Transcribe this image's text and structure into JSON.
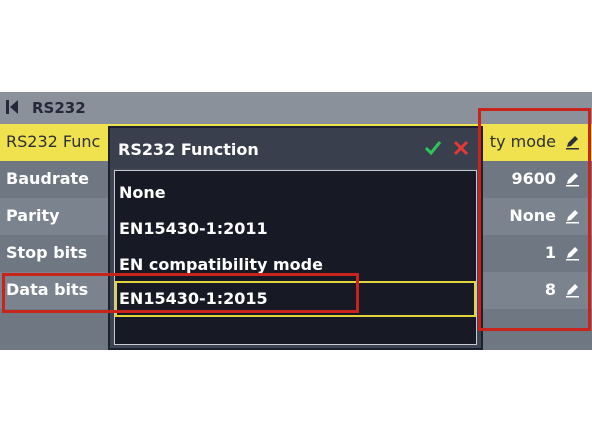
{
  "titlebar": {
    "title": "RS232"
  },
  "rows": [
    {
      "label": "RS232 Func",
      "value": "ty mode"
    },
    {
      "label": "Baudrate",
      "value": "9600"
    },
    {
      "label": "Parity",
      "value": "None"
    },
    {
      "label": "Stop bits",
      "value": "1"
    },
    {
      "label": "Data bits",
      "value": "8"
    }
  ],
  "dialog": {
    "title": "RS232 Function",
    "options": [
      "None",
      "EN15430-1:2011",
      "EN compatibility mode",
      "EN15430-1:2015"
    ],
    "selected_index": 3
  },
  "colors": {
    "accent_yellow": "#f0e14f",
    "ok_green": "#2fc45a",
    "cancel_red": "#e53935",
    "annotation_red": "#c8241c"
  },
  "icons": [
    "back-icon",
    "edit-icon",
    "check-icon",
    "close-icon"
  ]
}
